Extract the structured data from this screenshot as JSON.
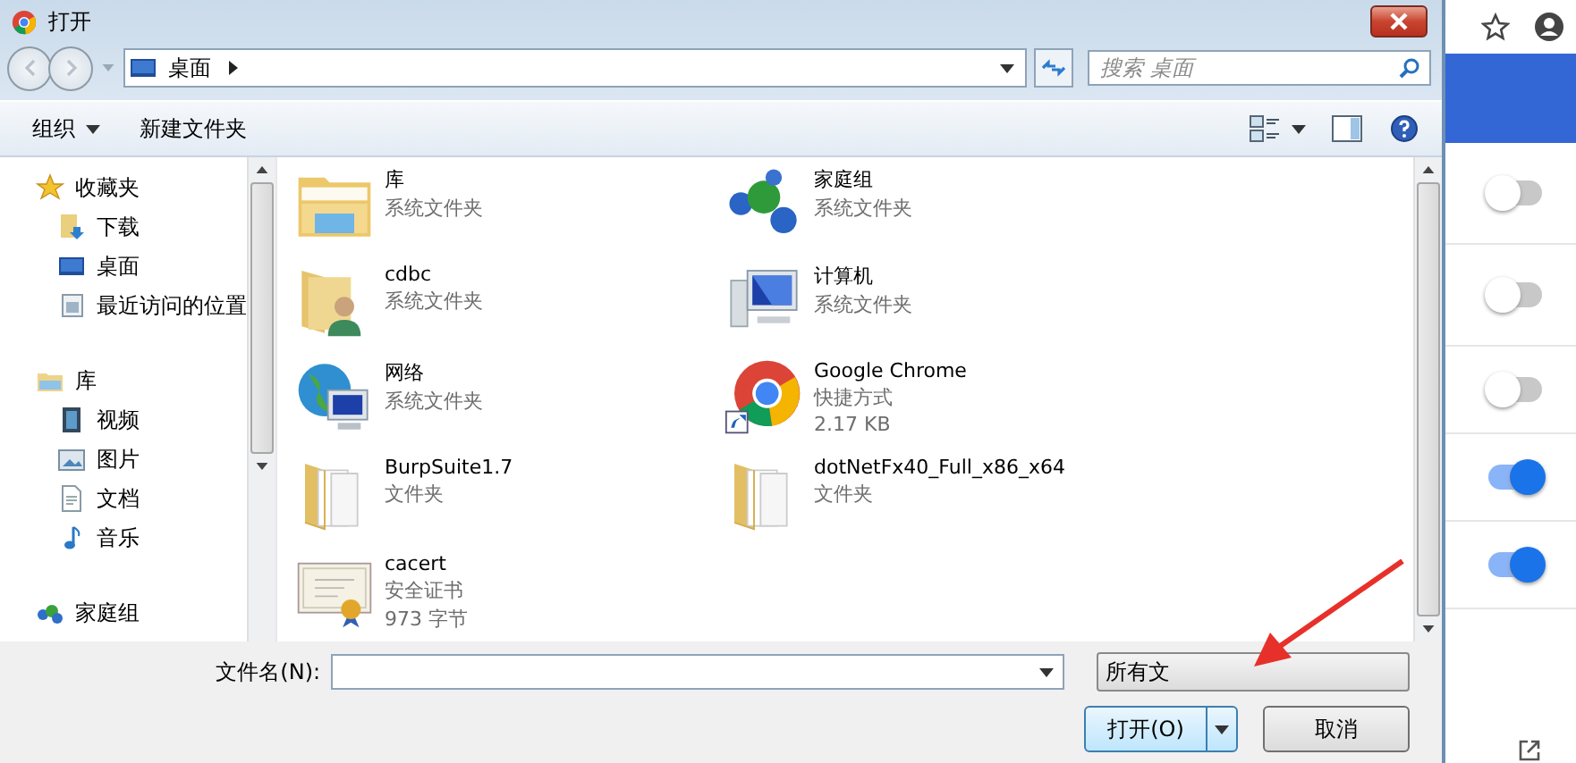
{
  "window": {
    "title": "打开"
  },
  "address_bar": {
    "path": "桌面"
  },
  "search": {
    "placeholder": "搜索 桌面"
  },
  "toolbar": {
    "organize": "组织",
    "new_folder": "新建文件夹"
  },
  "nav": [
    {
      "label": "收藏夹",
      "kind": "star",
      "children": [
        {
          "label": "下载",
          "kind": "download"
        },
        {
          "label": "桌面",
          "kind": "desktop"
        },
        {
          "label": "最近访问的位置",
          "kind": "recent"
        }
      ]
    },
    {
      "label": "库",
      "kind": "library",
      "children": [
        {
          "label": "视频",
          "kind": "video"
        },
        {
          "label": "图片",
          "kind": "picture"
        },
        {
          "label": "文档",
          "kind": "document"
        },
        {
          "label": "音乐",
          "kind": "music"
        }
      ]
    },
    {
      "label": "家庭组",
      "kind": "homegroup"
    }
  ],
  "files": [
    {
      "name": "库",
      "details": [
        "系统文件夹"
      ],
      "kind": "library"
    },
    {
      "name": "家庭组",
      "details": [
        "系统文件夹"
      ],
      "kind": "homegroup"
    },
    {
      "name": "cdbc",
      "details": [
        "系统文件夹"
      ],
      "kind": "user-folder"
    },
    {
      "name": "计算机",
      "details": [
        "系统文件夹"
      ],
      "kind": "computer"
    },
    {
      "name": "网络",
      "details": [
        "系统文件夹"
      ],
      "kind": "network"
    },
    {
      "name": "Google Chrome",
      "details": [
        "快捷方式",
        "2.17 KB"
      ],
      "kind": "chrome"
    },
    {
      "name": "BurpSuite1.7",
      "details": [
        "文件夹"
      ],
      "kind": "folder"
    },
    {
      "name": "dotNetFx40_Full_x86_x64",
      "details": [
        "文件夹"
      ],
      "kind": "folder"
    },
    {
      "name": "cacert",
      "details": [
        "安全证书",
        "973 字节"
      ],
      "kind": "certificate"
    }
  ],
  "file_name": {
    "label": "文件名(N):"
  },
  "file_type": {
    "value": "所有文"
  },
  "buttons": {
    "open": "打开(O)",
    "cancel": "取消"
  },
  "background_toggles": [
    {
      "on": false
    },
    {
      "on": false
    },
    {
      "on": false
    },
    {
      "on": true
    },
    {
      "on": true
    }
  ]
}
